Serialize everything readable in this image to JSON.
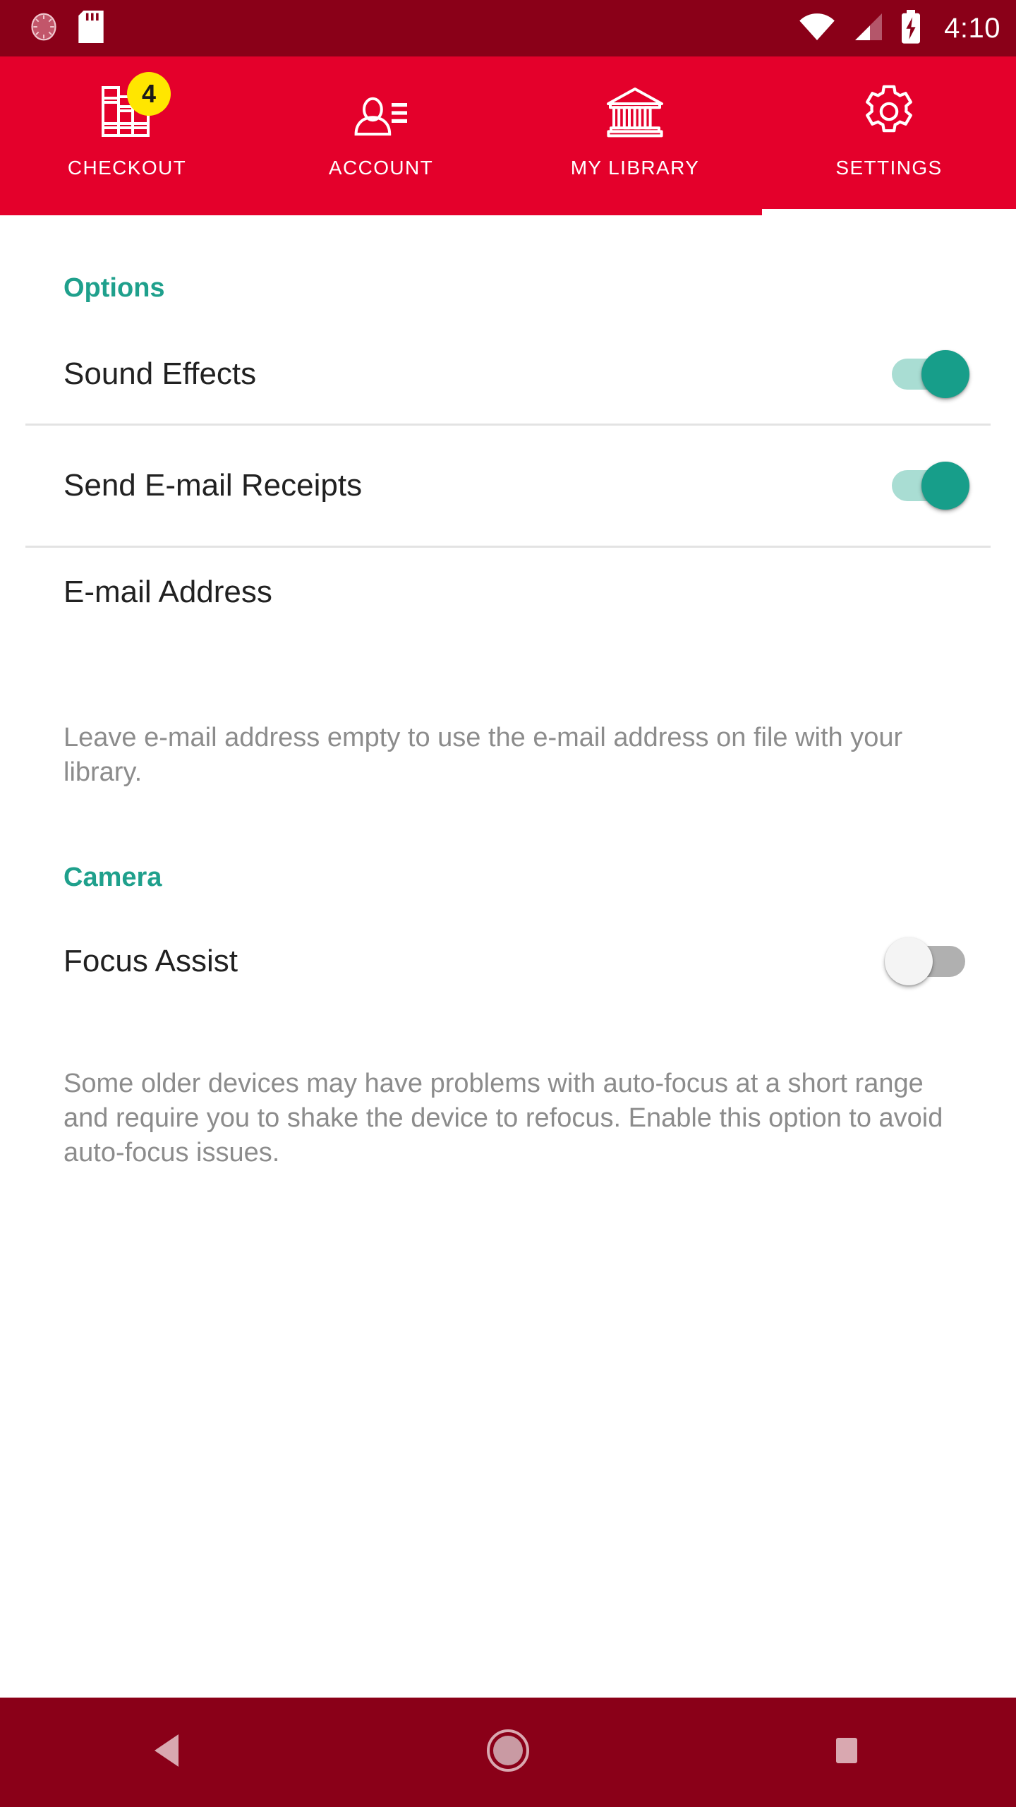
{
  "status_bar": {
    "left_icons": [
      "screen-record-icon",
      "sd-card-icon"
    ],
    "right_icons": [
      "wifi-icon",
      "cell-signal-icon",
      "battery-charging-icon"
    ],
    "clock": "4:10",
    "background_color": "#8a0018"
  },
  "tabs": {
    "accent_color": "#e4002b",
    "active_index": 3,
    "items": [
      {
        "label": "CHECKOUT",
        "icon": "books-icon",
        "badge": "4"
      },
      {
        "label": "ACCOUNT",
        "icon": "person-card-icon",
        "badge": ""
      },
      {
        "label": "MY LIBRARY",
        "icon": "library-building-icon",
        "badge": ""
      },
      {
        "label": "SETTINGS",
        "icon": "gear-icon",
        "badge": ""
      }
    ]
  },
  "settings": {
    "section_color": "#1fa08c",
    "options_section": {
      "header": "Options",
      "sound_effects": {
        "label": "Sound Effects",
        "state": "on"
      },
      "email_receipts": {
        "label": "Send E-mail Receipts",
        "state": "on"
      },
      "email_address": {
        "label": "E-mail Address",
        "value": "",
        "placeholder": "",
        "helper": "Leave e-mail address empty to use the e-mail address on file with your library."
      }
    },
    "camera_section": {
      "header": "Camera",
      "focus_assist": {
        "label": "Focus Assist",
        "state": "off",
        "helper": "Some older devices may have problems with auto-focus at a short range and require you to shake the device to refocus. Enable this option to avoid auto-focus issues."
      }
    }
  },
  "nav_bar": {
    "background_color": "#8a0018",
    "buttons": [
      {
        "name": "back-button",
        "icon": "triangle-back-icon"
      },
      {
        "name": "home-button",
        "icon": "circle-home-icon"
      },
      {
        "name": "recents-button",
        "icon": "square-recents-icon"
      }
    ]
  }
}
